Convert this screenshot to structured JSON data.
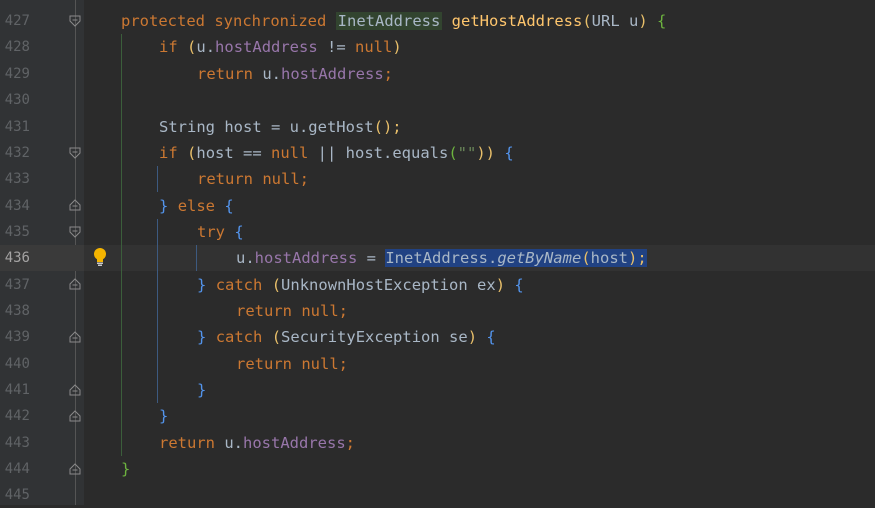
{
  "gutter": {
    "line_numbers": [
      "427",
      "428",
      "429",
      "430",
      "431",
      "432",
      "433",
      "434",
      "435",
      "436",
      "437",
      "438",
      "439",
      "440",
      "441",
      "442",
      "443",
      "444",
      "445"
    ]
  },
  "code": {
    "l427": {
      "kw1": "protected",
      "kw2": "synchronized",
      "type": "InetAddress",
      "fn": "getHostAddress",
      "p1": "(",
      "arg": "URL u",
      "p2": ")",
      "brace": "{"
    },
    "l428": {
      "kw": "if",
      "p1": "(",
      "t1": "u.",
      "f": "hostAddress",
      "t2": " != ",
      "kw2": "null",
      "p2": ")"
    },
    "l429": {
      "kw": "return",
      "t1": "u.",
      "f": "hostAddress",
      "t2": ";"
    },
    "l431": {
      "t1": "String host = u.getHost",
      "p": "();"
    },
    "l432": {
      "kw": "if",
      "p1": "(",
      "t1": "host == ",
      "kw2": "null",
      "t2": " || host.equals",
      "p2": "(",
      "s": "\"\"",
      "p3": "))",
      "b": "{"
    },
    "l433": {
      "kw": "return",
      "t1": " ",
      "kw2": "null",
      "t2": ";"
    },
    "l434": {
      "b1": "}",
      "kw": "else",
      "b2": "{"
    },
    "l435": {
      "kw": "try",
      "b": "{"
    },
    "l436": {
      "t1": "u.",
      "f": "hostAddress",
      "t2": " = ",
      "sel1": "InetAddress.",
      "sel2": "getByName",
      "sel3": "(",
      "sel4": "host",
      "sel5": ");"
    },
    "l437": {
      "b1": "}",
      "kw": "catch",
      "p1": "(",
      "t1": "UnknownHostException ex",
      "p2": ")",
      "b2": "{"
    },
    "l438": {
      "kw": "return",
      "kw2": "null",
      "t": ";"
    },
    "l439": {
      "b1": "}",
      "kw": "catch",
      "p1": "(",
      "t1": "SecurityException se",
      "p2": ")",
      "b2": "{"
    },
    "l440": {
      "kw": "return",
      "kw2": "null",
      "t": ";"
    },
    "l441": {
      "b": "}"
    },
    "l442": {
      "b": "}"
    },
    "l443": {
      "kw": "return",
      "t1": " u.",
      "f": "hostAddress",
      "t2": ";"
    },
    "l444": {
      "b": "}"
    }
  },
  "icons": {
    "bulb": "lightbulb-icon",
    "fold": "fold-marker-icon"
  }
}
